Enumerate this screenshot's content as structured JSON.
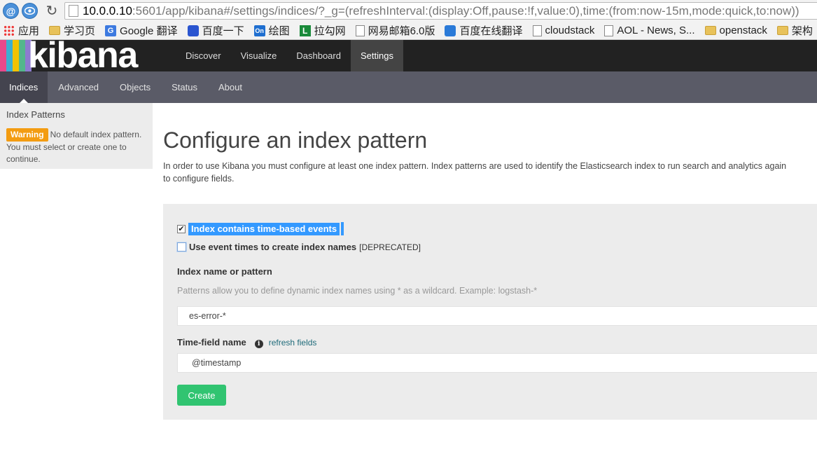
{
  "browser": {
    "url_host": "10.0.0.10",
    "url_rest": ":5601/app/kibana#/settings/indices/?_g=(refreshInterval:(display:Off,pause:!f,value:0),time:(from:now-15m,mode:quick,to:now))",
    "ext1": "@",
    "reload_glyph": "↻",
    "bookmarks": [
      {
        "label": "应用",
        "icon": "apps-icon"
      },
      {
        "label": "学习页",
        "icon": "folder-icon"
      },
      {
        "label": "Google 翻译",
        "icon": "google-translate-icon"
      },
      {
        "label": "百度一下",
        "icon": "baidu-icon"
      },
      {
        "label": "绘图",
        "icon": "onenote-icon"
      },
      {
        "label": "拉勾网",
        "icon": "lagou-icon"
      },
      {
        "label": "网易邮箱6.0版",
        "icon": "page-icon"
      },
      {
        "label": "百度在线翻译",
        "icon": "baidu-translate-icon"
      },
      {
        "label": "cloudstack",
        "icon": "page-icon"
      },
      {
        "label": "AOL - News, S...",
        "icon": "page-icon"
      },
      {
        "label": "openstack",
        "icon": "folder-icon"
      },
      {
        "label": "架构",
        "icon": "folder-icon"
      }
    ]
  },
  "kibana": {
    "logo": "kibana",
    "stripe_colors": [
      "#e8488b",
      "#3caed2",
      "#f2c200",
      "#53b78c",
      "#8d7bd0"
    ],
    "nav": [
      "Discover",
      "Visualize",
      "Dashboard",
      "Settings"
    ],
    "active_nav": "Settings",
    "subnav": [
      "Indices",
      "Advanced",
      "Objects",
      "Status",
      "About"
    ],
    "active_subnav": "Indices"
  },
  "sidebar": {
    "title": "Index Patterns",
    "warning_badge": "Warning",
    "warning_text_1": "No default index pattern.",
    "warning_text_2": "You must select or create one to continue."
  },
  "main": {
    "title": "Configure an index pattern",
    "intro_1": "In order to use Kibana you must configure at least one index pattern. Index patterns are used to identify the Elasticsearch index to run search and analytics again",
    "intro_2": "to configure fields.",
    "checkbox_time_based": {
      "label": "Index contains time-based events",
      "checked": true
    },
    "checkbox_event_times": {
      "label": "Use event times to create index names",
      "suffix": "[DEPRECATED]",
      "checked": false
    },
    "index_name_label": "Index name or pattern",
    "index_help": "Patterns allow you to define dynamic index names using * as a wildcard. Example: logstash-*",
    "index_value": "es-error-*",
    "time_field_label": "Time-field name",
    "refresh_fields": "refresh fields",
    "time_field_value": "@timestamp",
    "create_button": "Create"
  }
}
